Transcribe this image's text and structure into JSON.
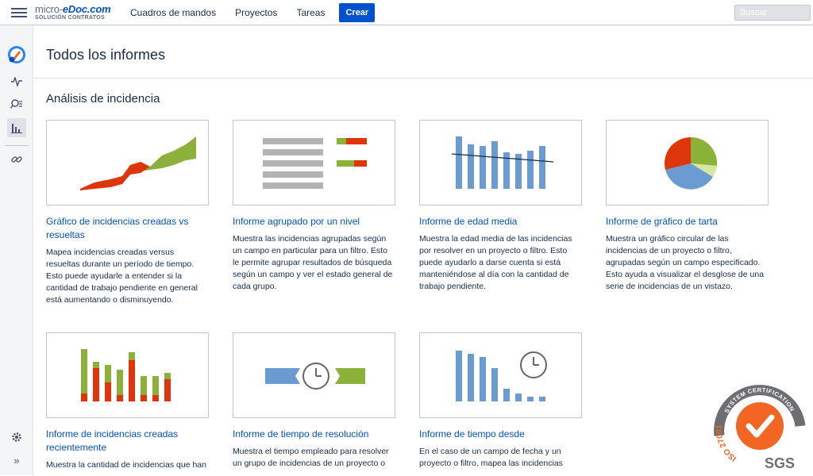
{
  "topbar": {
    "logo_main": "micro-",
    "logo_brand": "eDoc.com",
    "logo_sub": "SOLUCIÓN CONTRATOS",
    "nav": [
      "Cuadros de mandos",
      "Proyectos",
      "Tareas"
    ],
    "create_label": "Crear",
    "search_placeholder": "Buscar"
  },
  "page": {
    "title": "Todos los informes",
    "section_title": "Análisis de incidencia"
  },
  "reports": [
    {
      "title": "Gráfico de incidencias creadas vs resueltas",
      "description": "Mapea incidencias creadas versus resueltas durante un período de tiempo. Esto puede ayudarle a entender si la cantidad de trabajo pendiente en general está aumentando o disminuyendo.",
      "icon": "created-vs-resolved-chart"
    },
    {
      "title": "Informe agrupado por un nivel",
      "description": "Muestra las incidencias agrupadas según un campo en particular para un filtro. Esto le permite agrupar resultados de búsqueda según un campo y ver el estado general de cada grupo.",
      "icon": "grouped-list-chart"
    },
    {
      "title": "Informe de edad media",
      "description": "Muestra la edad media de las incidencias por resolver en un proyecto o filtro. Esto puede ayudarlo a darse cuenta si está manteniéndose al día con la cantidad de trabajo pendiente.",
      "icon": "average-age-chart"
    },
    {
      "title": "Informe de gráfico de tarta",
      "description": "Muestra un gráfico circular de las incidencias de un proyecto o filtro, agrupadas según un campo especificado. Esto ayuda a visualizar el desglose de una serie de incidencias de un vistazo.",
      "icon": "pie-chart"
    },
    {
      "title": "Informe de incidencias creadas recientemente",
      "description": "Muestra la cantidad de incidencias que han",
      "icon": "recently-created-chart"
    },
    {
      "title": "Informe de tiempo de resolución",
      "description": "Muestra el tiempo empleado para resolver un grupo de incidencias de un proyecto o",
      "icon": "resolution-time-chart"
    },
    {
      "title": "Informe de tiempo desde",
      "description": "En el caso de un campo de fecha y un proyecto o filtro, mapea las incidencias",
      "icon": "time-since-chart"
    }
  ],
  "seal": {
    "ring_text": "SYSTEM CERTIFICATION",
    "iso_text": "ISO 27001",
    "brand": "SGS"
  },
  "colors": {
    "link": "#0052cc",
    "primary_button": "#0052cc",
    "chart_red": "#de350b",
    "chart_green": "#8bb13a",
    "chart_blue": "#6a9bd1",
    "chart_grey": "#b3b3b3",
    "seal_orange": "#f26522"
  }
}
